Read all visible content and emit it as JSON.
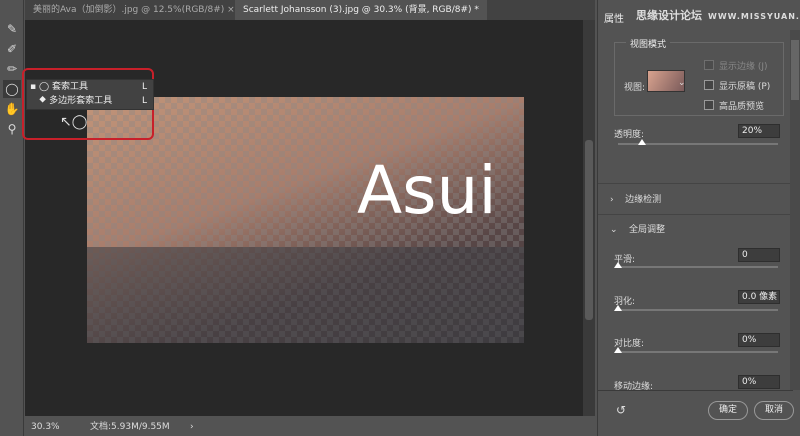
{
  "tabs": [
    {
      "label": "美丽的Ava（加倒影）.jpg @ 12.5%(RGB/8#)",
      "close": "×"
    },
    {
      "label": "Scarlett Johansson (3).jpg @ 30.3% (背景, RGB/8#) *"
    }
  ],
  "tools": [
    "quick-selection",
    "refine-brush",
    "brush",
    "lasso",
    "hand",
    "zoom"
  ],
  "flyout": {
    "items": [
      {
        "label": "套索工具",
        "key": "L",
        "selected": true
      },
      {
        "label": "多边形套索工具",
        "key": "L"
      }
    ]
  },
  "canvas": {
    "overlay_text": "Asui"
  },
  "status": {
    "zoom": "30.3%",
    "doc": "文档:5.93M/9.55M"
  },
  "panel": {
    "title": "属性",
    "watermark": "思缘设计论坛",
    "watermark_url": "WWW.MISSYUAN.COM",
    "view_mode": {
      "label": "视图模式",
      "view_label": "视图:",
      "show_edge": "显示边缘 (J)",
      "show_original": "显示原稿 (P)",
      "hq_preview": "高品质预览"
    },
    "opacity": {
      "label": "透明度:",
      "value": "20%",
      "percent": 20
    },
    "edge_detection": "边缘检测",
    "global": {
      "label": "全局调整",
      "smooth": {
        "label": "平滑:",
        "value": "0"
      },
      "feather": {
        "label": "羽化:",
        "value": "0.0 像素"
      },
      "contrast": {
        "label": "对比度:",
        "value": "0%"
      },
      "shift": {
        "label": "移动边缘:",
        "value": "0%"
      }
    },
    "ok": "确定",
    "cancel": "取消"
  }
}
